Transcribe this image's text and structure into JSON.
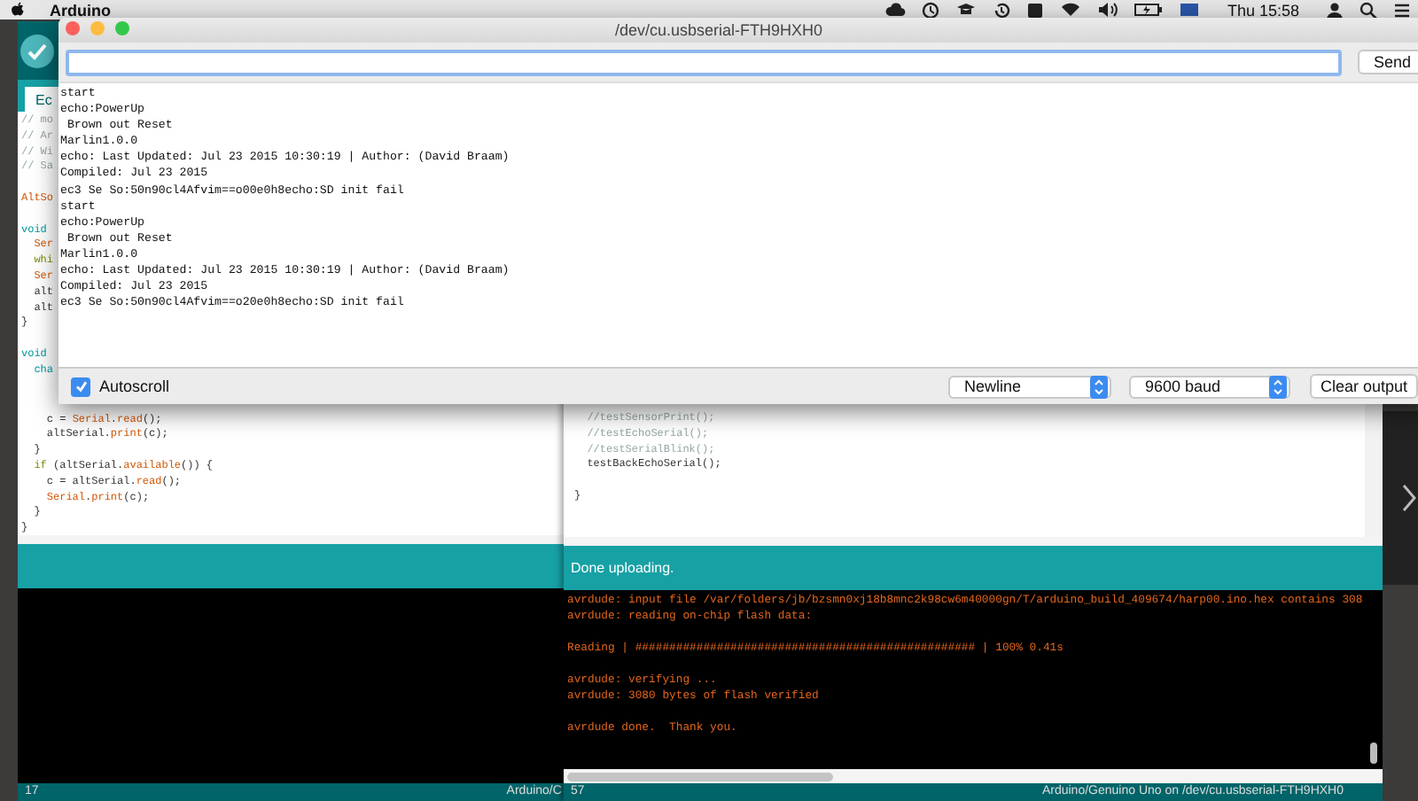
{
  "menu_bar": {
    "app_name": "Arduino",
    "clock": "Thu 15:58"
  },
  "sketch_window_back": {
    "tab_label": "Ec",
    "upper_fragments": [
      {
        "parts": [
          {
            "text": "// mo",
            "kind": "comment"
          }
        ]
      },
      {
        "parts": [
          {
            "text": "// Ar",
            "kind": "comment"
          }
        ]
      },
      {
        "parts": [
          {
            "text": "// Wi",
            "kind": "comment"
          }
        ]
      },
      {
        "parts": [
          {
            "text": "// Sa",
            "kind": "comment"
          }
        ]
      },
      {
        "kind": "blank"
      },
      {
        "parts": [
          {
            "text": "AltSo",
            "kind": "keyword"
          }
        ]
      },
      {
        "kind": "blank"
      },
      {
        "parts": [
          {
            "text": "void",
            "kind": "type"
          }
        ]
      },
      {
        "parts": [
          {
            "text": "  Ser",
            "kind": "keyword"
          }
        ]
      },
      {
        "parts": [
          {
            "text": "  whi",
            "kind": "control"
          }
        ]
      },
      {
        "parts": [
          {
            "text": "  Ser",
            "kind": "keyword"
          }
        ]
      },
      {
        "parts": [
          {
            "text": "  alt"
          }
        ]
      },
      {
        "parts": [
          {
            "text": "  alt"
          }
        ]
      },
      {
        "parts": [
          {
            "text": "}"
          }
        ]
      },
      {
        "kind": "blank"
      },
      {
        "parts": [
          {
            "text": "void",
            "kind": "type"
          }
        ]
      },
      {
        "parts": [
          {
            "text": "  cha",
            "kind": "type"
          }
        ]
      }
    ],
    "lower_lines": [
      {
        "parts": [
          {
            "text": "    c = "
          },
          {
            "text": "Serial",
            "kind": "keyword"
          },
          {
            "text": "."
          },
          {
            "text": "read",
            "kind": "keyword"
          },
          {
            "text": "();"
          }
        ]
      },
      {
        "parts": [
          {
            "text": "    altSerial."
          },
          {
            "text": "print",
            "kind": "keyword"
          },
          {
            "text": "(c);"
          }
        ]
      },
      {
        "parts": [
          {
            "text": "  }"
          }
        ]
      },
      {
        "parts": [
          {
            "text": "  if",
            "kind": "control"
          },
          {
            "text": " (altSerial."
          },
          {
            "text": "available",
            "kind": "keyword"
          },
          {
            "text": "()) {"
          }
        ]
      },
      {
        "parts": [
          {
            "text": "    c = altSerial."
          },
          {
            "text": "read",
            "kind": "keyword"
          },
          {
            "text": "();"
          }
        ]
      },
      {
        "parts": [
          {
            "text": "    Serial",
            "kind": "keyword"
          },
          {
            "text": "."
          },
          {
            "text": "print",
            "kind": "keyword"
          },
          {
            "text": "(c);"
          }
        ]
      },
      {
        "parts": [
          {
            "text": "  }"
          }
        ]
      },
      {
        "parts": [
          {
            "text": "}"
          }
        ]
      }
    ],
    "footer_line": "17",
    "footer_board": "Arduino/C"
  },
  "sketch_window_front": {
    "code_lines": [
      {
        "parts": [
          {
            "text": "  //testSensorPrint();",
            "kind": "comment"
          }
        ]
      },
      {
        "parts": [
          {
            "text": "  //testEchoSerial();",
            "kind": "comment"
          }
        ]
      },
      {
        "parts": [
          {
            "text": "  //testSerialBlink();",
            "kind": "comment"
          }
        ]
      },
      {
        "parts": [
          {
            "text": "  testBackEchoSerial();"
          }
        ]
      },
      {
        "kind": "blank"
      },
      {
        "parts": [
          {
            "text": "}"
          }
        ]
      }
    ],
    "status_message": "Done uploading.",
    "console_lines": [
      {
        "text": "avrdude: input file /var/folders/jb/bzsmn0xj18b8mnc2k98cw6m40000gn/T/arduino_build_409674/harp00.ino.hex contains 308"
      },
      {
        "text": "avrdude: reading on-chip flash data:"
      },
      {
        "kind": "blank"
      },
      {
        "text": "Reading | ################################################## | 100% 0.41s"
      },
      {
        "kind": "blank"
      },
      {
        "text": "avrdude: verifying ..."
      },
      {
        "text": "avrdude: 3080 bytes of flash verified"
      },
      {
        "kind": "blank"
      },
      {
        "text": "avrdude done.  Thank you."
      }
    ],
    "footer_text": "57",
    "footer_board": "Arduino/Genuino Uno on /dev/cu.usbserial-FTH9HXH0"
  },
  "serial_monitor": {
    "title": "/dev/cu.usbserial-FTH9HXH0",
    "send_label": "Send",
    "output_lines": [
      "start",
      "echo:PowerUp",
      " Brown out Reset",
      "Marlin1.0.0",
      "echo: Last Updated: Jul 23 2015 10:30:19 | Author: (David Braam)",
      "Compiled: Jul 23 2015",
      "ec3 Se So:50n90cl4Afvim==o00e0h8echo:SD init fail",
      "start",
      "echo:PowerUp",
      " Brown out Reset",
      "Marlin1.0.0",
      "echo: Last Updated: Jul 23 2015 10:30:19 | Author: (David Braam)",
      "Compiled: Jul 23 2015",
      "ec3 Se So:50n90cl4Afvim==o20e0h8echo:SD init fail"
    ],
    "autoscroll": {
      "label": "Autoscroll",
      "checked": true
    },
    "line_ending": "Newline",
    "baud_rate": "9600 baud",
    "clear_label": "Clear output"
  }
}
